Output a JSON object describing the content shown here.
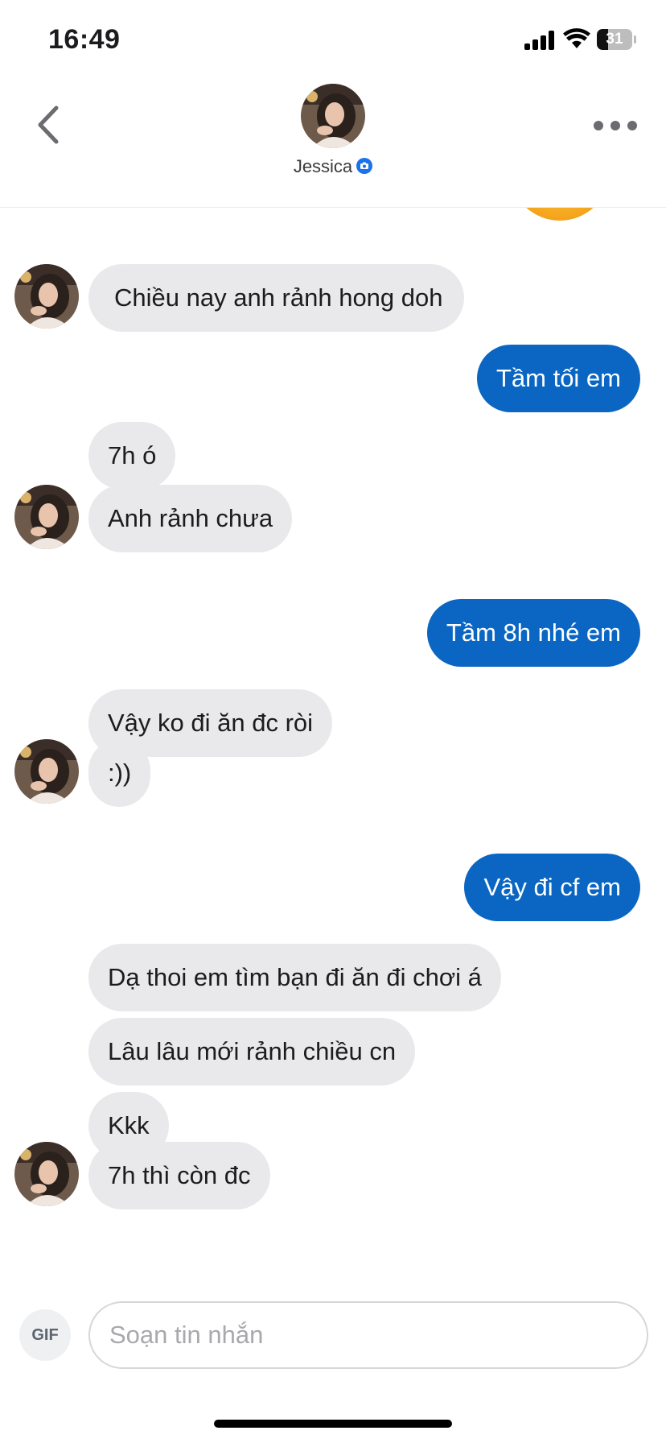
{
  "status_bar": {
    "time": "16:49",
    "battery": "31",
    "battery_level": 0.31
  },
  "header": {
    "contact_name": "Jessica"
  },
  "messages": [
    {
      "from": "contact",
      "text": "Chiều nay anh rảnh hong doh"
    },
    {
      "from": "me",
      "text": "Tầm tối em"
    },
    {
      "from": "contact",
      "text": "7h ó"
    },
    {
      "from": "contact",
      "text": "Anh rảnh chưa"
    },
    {
      "from": "me",
      "text": "Tầm 8h nhé em"
    },
    {
      "from": "contact",
      "text": "Vậy ko đi ăn đc ròi"
    },
    {
      "from": "contact",
      "text": ":))"
    },
    {
      "from": "me",
      "text": "Vậy đi cf em"
    },
    {
      "from": "contact",
      "text": "Dạ thoi em tìm bạn đi ăn đi chơi á"
    },
    {
      "from": "contact",
      "text": "Lâu lâu mới rảnh chiều cn"
    },
    {
      "from": "contact",
      "text": "Kkk"
    },
    {
      "from": "contact",
      "text": "7h thì còn đc"
    }
  ],
  "composer": {
    "gif_label": "GIF",
    "placeholder": "Soạn tin nhắn"
  },
  "colors": {
    "outgoing_bubble": "#0a66c2",
    "incoming_bubble": "#e9e9eb"
  },
  "icons": {
    "back": "chevron-left-icon",
    "more": "more-dots-icon",
    "verified": "camera-badge-icon"
  }
}
